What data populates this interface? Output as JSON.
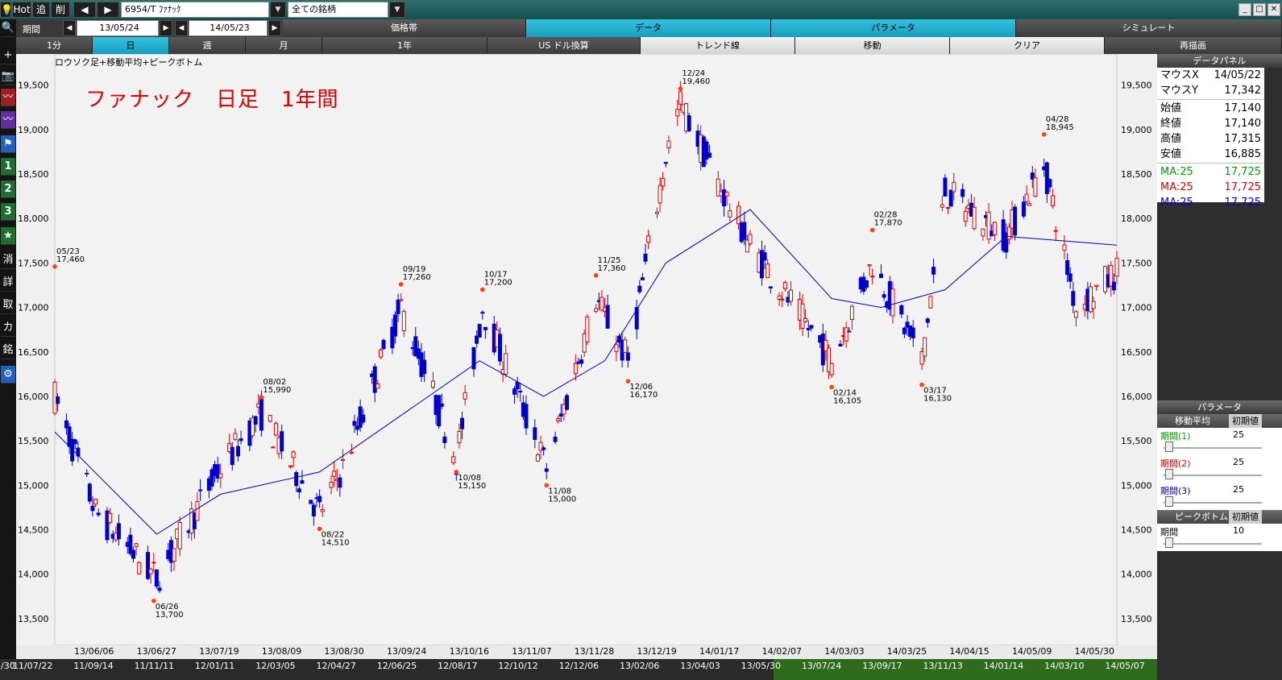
{
  "toolbar": {
    "hot": "Hot",
    "add": "追",
    "del": "削",
    "prev": "◀",
    "next": "▶",
    "symbol": "6954/T ﾌｧﾅｯｸ",
    "universe": "全ての銘柄",
    "dropdown": "▼",
    "window_buttons": [
      "_",
      "□",
      "✕"
    ]
  },
  "period": {
    "label": "期間",
    "from": "13/05/24",
    "tilde": "~",
    "to": "14/05/23"
  },
  "tabs_top": [
    "価格帯",
    "データ",
    "パラメータ",
    "シミュレート"
  ],
  "tabs_second": [
    "1分",
    "日",
    "週",
    "月",
    "1年",
    "US ドル換算",
    "トレンド線",
    "移動",
    "クリア",
    "再描画"
  ],
  "sidebar_glyphs": [
    "💡",
    "🔍",
    "+",
    "📷",
    "〰",
    "〰",
    "⚑",
    "1",
    "2",
    "3",
    "★",
    "消",
    "詳",
    "取",
    "カ",
    "銘",
    "⚙"
  ],
  "chart_header": {
    "legend": "ロウソク足+移動平均+ピークボトム",
    "title": "ファナック　日足　1年間"
  },
  "right_axis": [
    "19,500",
    "19,000",
    "18,500",
    "18,000",
    "17,500",
    "17,000",
    "16,500",
    "16,000",
    "15,500",
    "15,000",
    "14,500",
    "14,000",
    "13,500"
  ],
  "date_axis": [
    "13/06/06",
    "13/06/27",
    "13/07/19",
    "13/08/09",
    "13/08/30",
    "13/09/24",
    "13/10/16",
    "13/11/07",
    "13/11/28",
    "13/12/19",
    "14/01/17",
    "14/02/07",
    "14/03/03",
    "14/03/25",
    "14/04/15",
    "14/05/09",
    "14/05/30"
  ],
  "timeline": [
    "5/30",
    "11/07/22",
    "11/09/14",
    "11/11/11",
    "12/01/11",
    "12/03/05",
    "12/04/27",
    "12/06/25",
    "12/08/17",
    "12/10/12",
    "12/12/06",
    "13/02/06",
    "13/04/03",
    "13/05/30",
    "13/07/24",
    "13/09/17",
    "13/11/13",
    "14/01/14",
    "14/03/10",
    "14/05/07"
  ],
  "data_panel": {
    "title": "データパネル",
    "rows": [
      {
        "label": "マウスX",
        "value": "14/05/22"
      },
      {
        "label": "マウスY",
        "value": "17,342"
      },
      {
        "label": "始値",
        "value": "17,140"
      },
      {
        "label": "終値",
        "value": "17,140"
      },
      {
        "label": "高値",
        "value": "17,315"
      },
      {
        "label": "安値",
        "value": "16,885"
      },
      {
        "label": "MA:25",
        "value": "17,725",
        "color": "#00a000"
      },
      {
        "label": "MA:25",
        "value": "17,725",
        "color": "#e00000"
      },
      {
        "label": "MA:25",
        "value": "17,725",
        "color": "#0000d0"
      }
    ]
  },
  "parameters": {
    "title": "パラメータ",
    "ma_header": "移動平均",
    "init_label": "初期値",
    "periods": [
      {
        "label": "期間(1)",
        "value": "25",
        "color": "#00a000"
      },
      {
        "label": "期間(2)",
        "value": "25",
        "color": "#e00000"
      },
      {
        "label": "期間(3)",
        "value": "25",
        "color": "#0000d0"
      }
    ],
    "peak_header": "ピークボトム",
    "peak_period_label": "期間",
    "peak_period_value": "10"
  },
  "chart_data": {
    "type": "candlestick",
    "title": "ファナック　日足　1年間",
    "legend": "ロウソク足+移動平均+ピークボトム",
    "ylim": [
      13200,
      19850
    ],
    "x_range": [
      "13/05/23",
      "14/05/23"
    ],
    "y_ticks": [
      13500,
      14000,
      14500,
      15000,
      15500,
      16000,
      16500,
      17000,
      17500,
      18000,
      18500,
      19000,
      19500
    ],
    "colors": {
      "up": "#e00000",
      "down": "#0000cc",
      "ma": "#0000cc",
      "peak": "#ff4400"
    },
    "moving_average": {
      "name": "MA:25",
      "x": [
        "13/05/23",
        "13/06/27",
        "13/07/19",
        "13/08/22",
        "13/09/24",
        "13/10/16",
        "13/11/07",
        "13/11/28",
        "13/12/19",
        "14/01/17",
        "14/02/14",
        "14/03/03",
        "14/03/25",
        "14/04/15",
        "14/05/23"
      ],
      "y": [
        15600,
        14450,
        14900,
        15150,
        15900,
        16400,
        16000,
        16400,
        17500,
        18100,
        17100,
        17000,
        17200,
        17800,
        17700
      ]
    },
    "peaks": [
      {
        "date": "05/23",
        "value": 17460,
        "label": "05/23\n17,460"
      },
      {
        "date": "06/26",
        "value": 13700,
        "label": "06/26\n13,700"
      },
      {
        "date": "08/02",
        "value": 15990,
        "label": "08/02\n15,990"
      },
      {
        "date": "08/22",
        "value": 14510,
        "label": "08/22\n14,510"
      },
      {
        "date": "09/19",
        "value": 17260,
        "label": "09/19\n17,260"
      },
      {
        "date": "10/08",
        "value": 15150,
        "label": "10/08\n15,150"
      },
      {
        "date": "10/17",
        "value": 17200,
        "label": "10/17\n17,200"
      },
      {
        "date": "11/08",
        "value": 15000,
        "label": "11/08\n15,000"
      },
      {
        "date": "11/25",
        "value": 17360,
        "label": "11/25\n17,360"
      },
      {
        "date": "12/06",
        "value": 16170,
        "label": "12/06\n16,170"
      },
      {
        "date": "12/24",
        "value": 19460,
        "label": "12/24\n19,460"
      },
      {
        "date": "02/14",
        "value": 16105,
        "label": "02/14\n16,105"
      },
      {
        "date": "02/28",
        "value": 17870,
        "label": "02/28\n17,870"
      },
      {
        "date": "03/17",
        "value": 16130,
        "label": "03/17\n16,130"
      },
      {
        "date": "04/28",
        "value": 18945,
        "label": "04/28\n18,945"
      }
    ],
    "close_path": [
      [
        "13/05/23",
        16000
      ],
      [
        "13/06/06",
        14700
      ],
      [
        "13/06/27",
        13950
      ],
      [
        "13/07/19",
        15200
      ],
      [
        "13/08/02",
        15800
      ],
      [
        "13/08/22",
        14700
      ],
      [
        "13/08/30",
        15200
      ],
      [
        "13/09/19",
        17000
      ],
      [
        "13/10/08",
        15300
      ],
      [
        "13/10/17",
        17000
      ],
      [
        "13/11/08",
        15200
      ],
      [
        "13/11/25",
        17100
      ],
      [
        "13/12/06",
        16400
      ],
      [
        "13/12/19",
        18700
      ],
      [
        "13/12/24",
        19300
      ],
      [
        "14/01/06",
        18400
      ],
      [
        "14/01/17",
        17700
      ],
      [
        "14/02/14",
        16400
      ],
      [
        "14/02/28",
        17500
      ],
      [
        "14/03/17",
        16400
      ],
      [
        "14/03/25",
        18300
      ],
      [
        "14/04/15",
        17800
      ],
      [
        "14/04/28",
        18600
      ],
      [
        "14/05/09",
        17000
      ],
      [
        "14/05/23",
        17400
      ]
    ]
  }
}
